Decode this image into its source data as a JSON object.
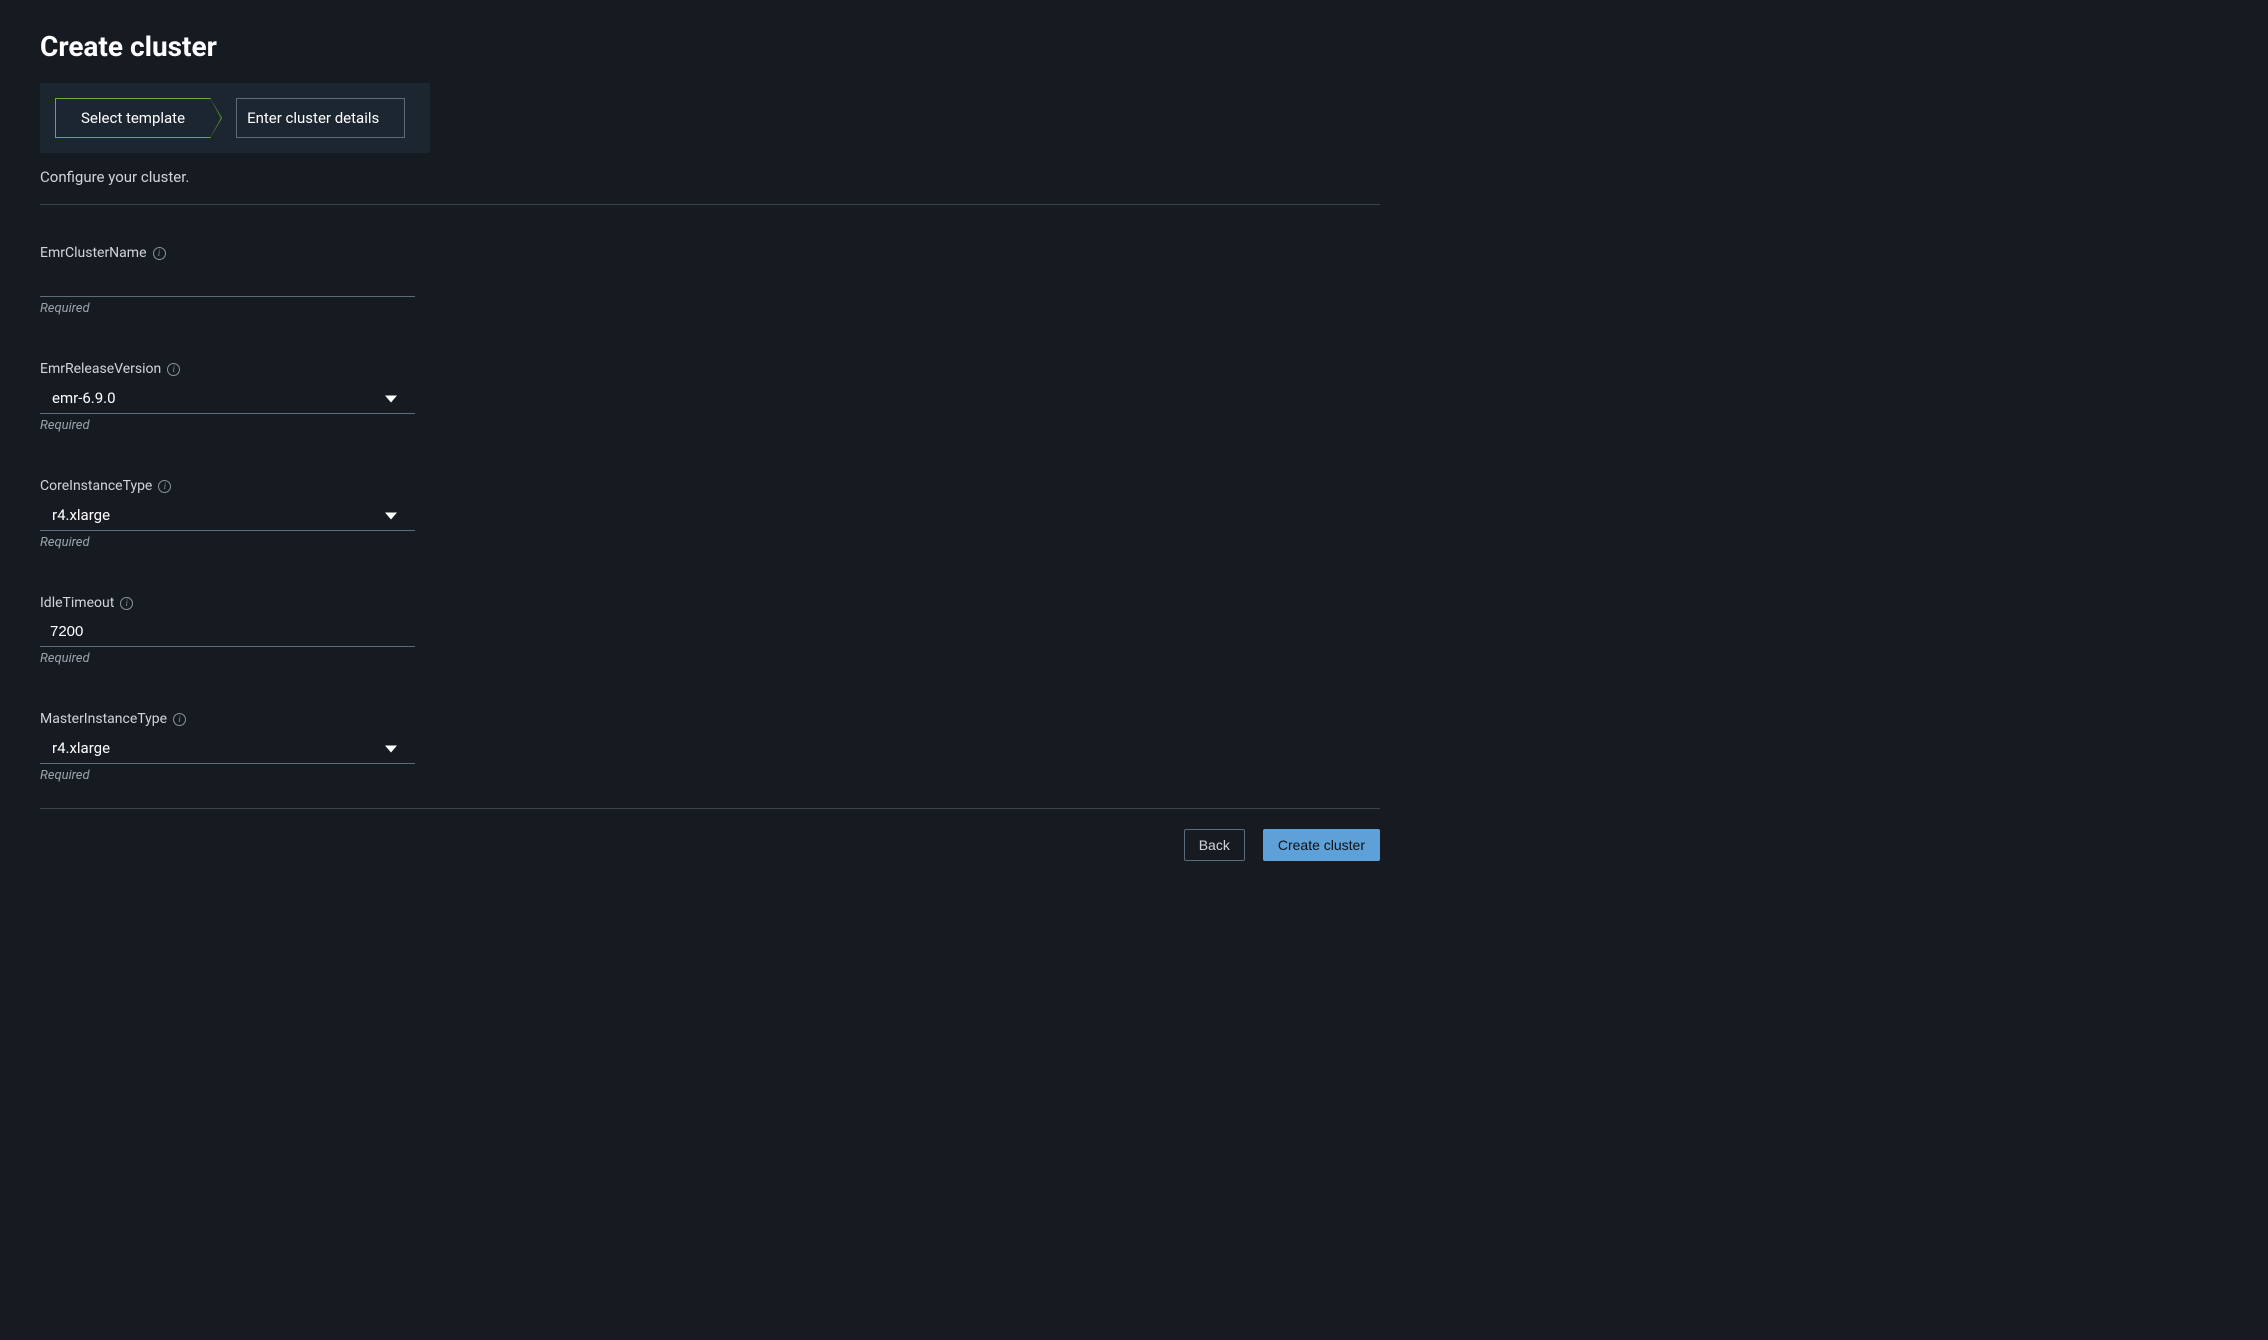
{
  "page": {
    "title": "Create cluster",
    "subtitle": "Configure your cluster."
  },
  "wizard": {
    "step1": "Select template",
    "step2": "Enter cluster details"
  },
  "fields": {
    "clusterName": {
      "label": "EmrClusterName",
      "value": "",
      "helper": "Required"
    },
    "releaseVersion": {
      "label": "EmrReleaseVersion",
      "value": "emr-6.9.0",
      "helper": "Required"
    },
    "coreInstanceType": {
      "label": "CoreInstanceType",
      "value": "r4.xlarge",
      "helper": "Required"
    },
    "idleTimeout": {
      "label": "IdleTimeout",
      "value": "7200",
      "helper": "Required"
    },
    "masterInstanceType": {
      "label": "MasterInstanceType",
      "value": "r4.xlarge",
      "helper": "Required"
    }
  },
  "actions": {
    "back": "Back",
    "create": "Create cluster"
  }
}
